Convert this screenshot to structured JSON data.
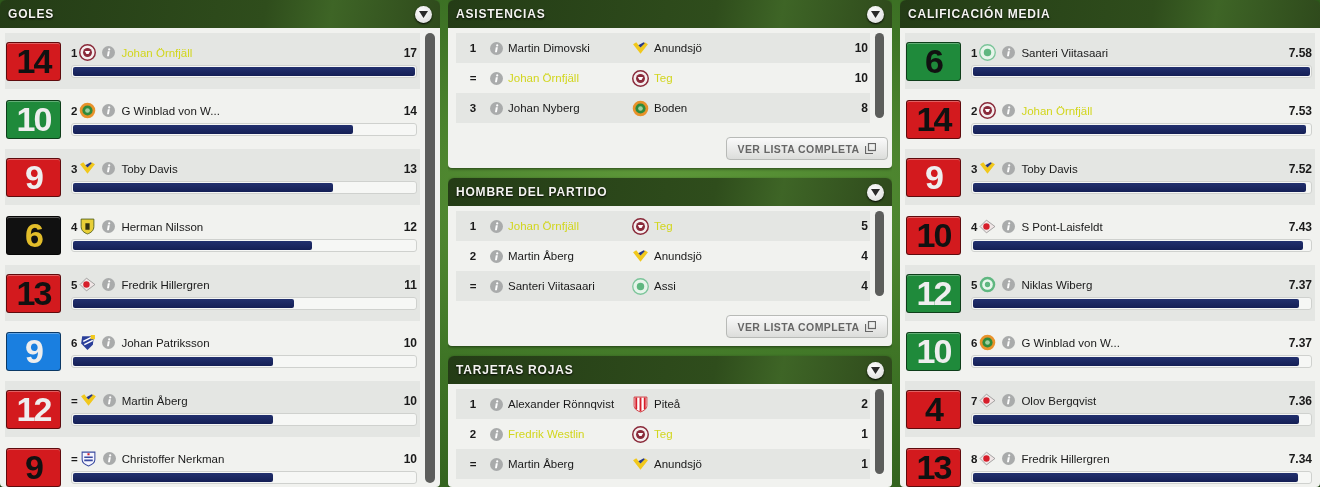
{
  "columns": [
    {
      "panels": [
        {
          "kind": "bars",
          "title": "GOLES",
          "menu_button": true,
          "rows": [
            {
              "shirt": {
                "number": "14",
                "color": "#d31a1e",
                "kind": "dark-number"
              },
              "rank": "1",
              "crest": {
                "kind": "maroon-ring"
              },
              "name": "Johan Örnfjäll",
              "highlighted": true,
              "value": "17",
              "level": 1
            },
            {
              "shirt": {
                "number": "10",
                "color": "#1f8a3b",
                "kind": "light-number"
              },
              "rank": "2",
              "crest": {
                "kind": "orange-ring"
              },
              "name": "G Winblad von W...",
              "highlighted": false,
              "value": "14",
              "level": 0.82
            },
            {
              "shirt": {
                "number": "9",
                "color": "#d31a1e",
                "kind": "light-number"
              },
              "rank": "3",
              "crest": {
                "kind": "yellow-chevron"
              },
              "name": "Toby Davis",
              "highlighted": false,
              "value": "13",
              "level": 0.76
            },
            {
              "shirt": {
                "number": "6",
                "color": "#111111",
                "kind": "gold-number"
              },
              "rank": "4",
              "crest": {
                "kind": "yellow-shield"
              },
              "name": "Herman Nilsson",
              "highlighted": false,
              "value": "12",
              "level": 0.7
            },
            {
              "shirt": {
                "number": "13",
                "color": "#d31a1e",
                "kind": "dark-number"
              },
              "rank": "5",
              "crest": {
                "kind": "red-arrow"
              },
              "name": "Fredrik Hillergren",
              "highlighted": false,
              "value": "11",
              "level": 0.645
            },
            {
              "shirt": {
                "number": "9",
                "color": "#1a7fe0",
                "kind": "light-number"
              },
              "rank": "6",
              "crest": {
                "kind": "blue-shield"
              },
              "name": "Johan Patriksson",
              "highlighted": false,
              "value": "10",
              "level": 0.585
            },
            {
              "shirt": {
                "number": "12",
                "color": "#d31a1e",
                "kind": "light-number"
              },
              "rank": "=",
              "crest": {
                "kind": "yellow-chevron"
              },
              "name": "Martin Åberg",
              "highlighted": false,
              "value": "10",
              "level": 0.585
            },
            {
              "shirt": {
                "number": "9",
                "color": "#d31a1e",
                "kind": "dark-number"
              },
              "rank": "=",
              "crest": {
                "kind": "blue-crest"
              },
              "name": "Christoffer Nerkman",
              "highlighted": false,
              "value": "10",
              "level": 0.585
            }
          ]
        }
      ]
    },
    {
      "panels": [
        {
          "kind": "table",
          "title": "ASISTENCIAS",
          "menu_button": true,
          "rows": [
            {
              "rank": "1",
              "name": "Martin Dimovski",
              "highlighted": false,
              "crest": {
                "kind": "yellow-chevron"
              },
              "club": "Anundsjö",
              "value": "10"
            },
            {
              "rank": "=",
              "name": "Johan Örnfjäll",
              "highlighted": true,
              "crest": {
                "kind": "maroon-ring"
              },
              "club": "Teg",
              "value": "10"
            },
            {
              "rank": "3",
              "name": "Johan Nyberg",
              "highlighted": false,
              "crest": {
                "kind": "orange-ring"
              },
              "club": "Boden",
              "value": "8"
            }
          ],
          "button": "VER LISTA COMPLETA"
        },
        {
          "kind": "table",
          "title": "HOMBRE DEL PARTIDO",
          "menu_button": true,
          "rows": [
            {
              "rank": "1",
              "name": "Johan Örnfjäll",
              "highlighted": true,
              "crest": {
                "kind": "maroon-ring"
              },
              "club": "Teg",
              "value": "5"
            },
            {
              "rank": "2",
              "name": "Martin Åberg",
              "highlighted": false,
              "crest": {
                "kind": "yellow-chevron"
              },
              "club": "Anundsjö",
              "value": "4"
            },
            {
              "rank": "=",
              "name": "Santeri Viitasaari",
              "highlighted": false,
              "crest": {
                "kind": "green-ring"
              },
              "club": "Assi",
              "value": "4"
            }
          ],
          "button": "VER LISTA COMPLETA"
        },
        {
          "kind": "table",
          "title": "TARJETAS ROJAS",
          "menu_button": true,
          "rows": [
            {
              "rank": "1",
              "name": "Alexander Rönnqvist",
              "highlighted": false,
              "crest": {
                "kind": "red-stripes"
              },
              "club": "Piteå",
              "value": "2"
            },
            {
              "rank": "2",
              "name": "Fredrik Westlin",
              "highlighted": true,
              "crest": {
                "kind": "maroon-ring"
              },
              "club": "Teg",
              "value": "1"
            },
            {
              "rank": "=",
              "name": "Martin Åberg",
              "highlighted": false,
              "crest": {
                "kind": "yellow-chevron"
              },
              "club": "Anundsjö",
              "value": "1"
            }
          ]
        }
      ]
    },
    {
      "panels": [
        {
          "kind": "bars",
          "title": "CALIFICACIÓN MEDIA",
          "rows": [
            {
              "shirt": {
                "number": "6",
                "color": "#1f8a3b",
                "kind": "dark-number"
              },
              "rank": "1",
              "crest": {
                "kind": "green-ring"
              },
              "name": "Santeri Viitasaari",
              "highlighted": false,
              "value": "7.58",
              "level": 1
            },
            {
              "shirt": {
                "number": "14",
                "color": "#d31a1e",
                "kind": "dark-number"
              },
              "rank": "2",
              "crest": {
                "kind": "maroon-ring"
              },
              "name": "Johan Örnfjäll",
              "highlighted": true,
              "value": "7.53",
              "level": 0.988
            },
            {
              "shirt": {
                "number": "9",
                "color": "#d31a1e",
                "kind": "light-number"
              },
              "rank": "3",
              "crest": {
                "kind": "yellow-chevron"
              },
              "name": "Toby Davis",
              "highlighted": false,
              "value": "7.52",
              "level": 0.988
            },
            {
              "shirt": {
                "number": "10",
                "color": "#d31a1e",
                "kind": "dark-number"
              },
              "rank": "4",
              "crest": {
                "kind": "red-arrow"
              },
              "name": "S Pont-Laisfeldt",
              "highlighted": false,
              "value": "7.43",
              "level": 0.978
            },
            {
              "shirt": {
                "number": "12",
                "color": "#1f8a3b",
                "kind": "light-number"
              },
              "rank": "5",
              "crest": {
                "kind": "green-badge"
              },
              "name": "Niklas Wiberg",
              "highlighted": false,
              "value": "7.37",
              "level": 0.968
            },
            {
              "shirt": {
                "number": "10",
                "color": "#1f8a3b",
                "kind": "light-number"
              },
              "rank": "6",
              "crest": {
                "kind": "orange-ring"
              },
              "name": "G Winblad von W...",
              "highlighted": false,
              "value": "7.37",
              "level": 0.968
            },
            {
              "shirt": {
                "number": "4",
                "color": "#d31a1e",
                "kind": "dark-number"
              },
              "rank": "7",
              "crest": {
                "kind": "red-arrow"
              },
              "name": "Olov Bergqvist",
              "highlighted": false,
              "value": "7.36",
              "level": 0.968
            },
            {
              "shirt": {
                "number": "13",
                "color": "#d31a1e",
                "kind": "dark-number"
              },
              "rank": "8",
              "crest": {
                "kind": "red-arrow"
              },
              "name": "Fredrik Hillergren",
              "highlighted": false,
              "value": "7.34",
              "level": 0.965
            }
          ]
        }
      ]
    }
  ]
}
